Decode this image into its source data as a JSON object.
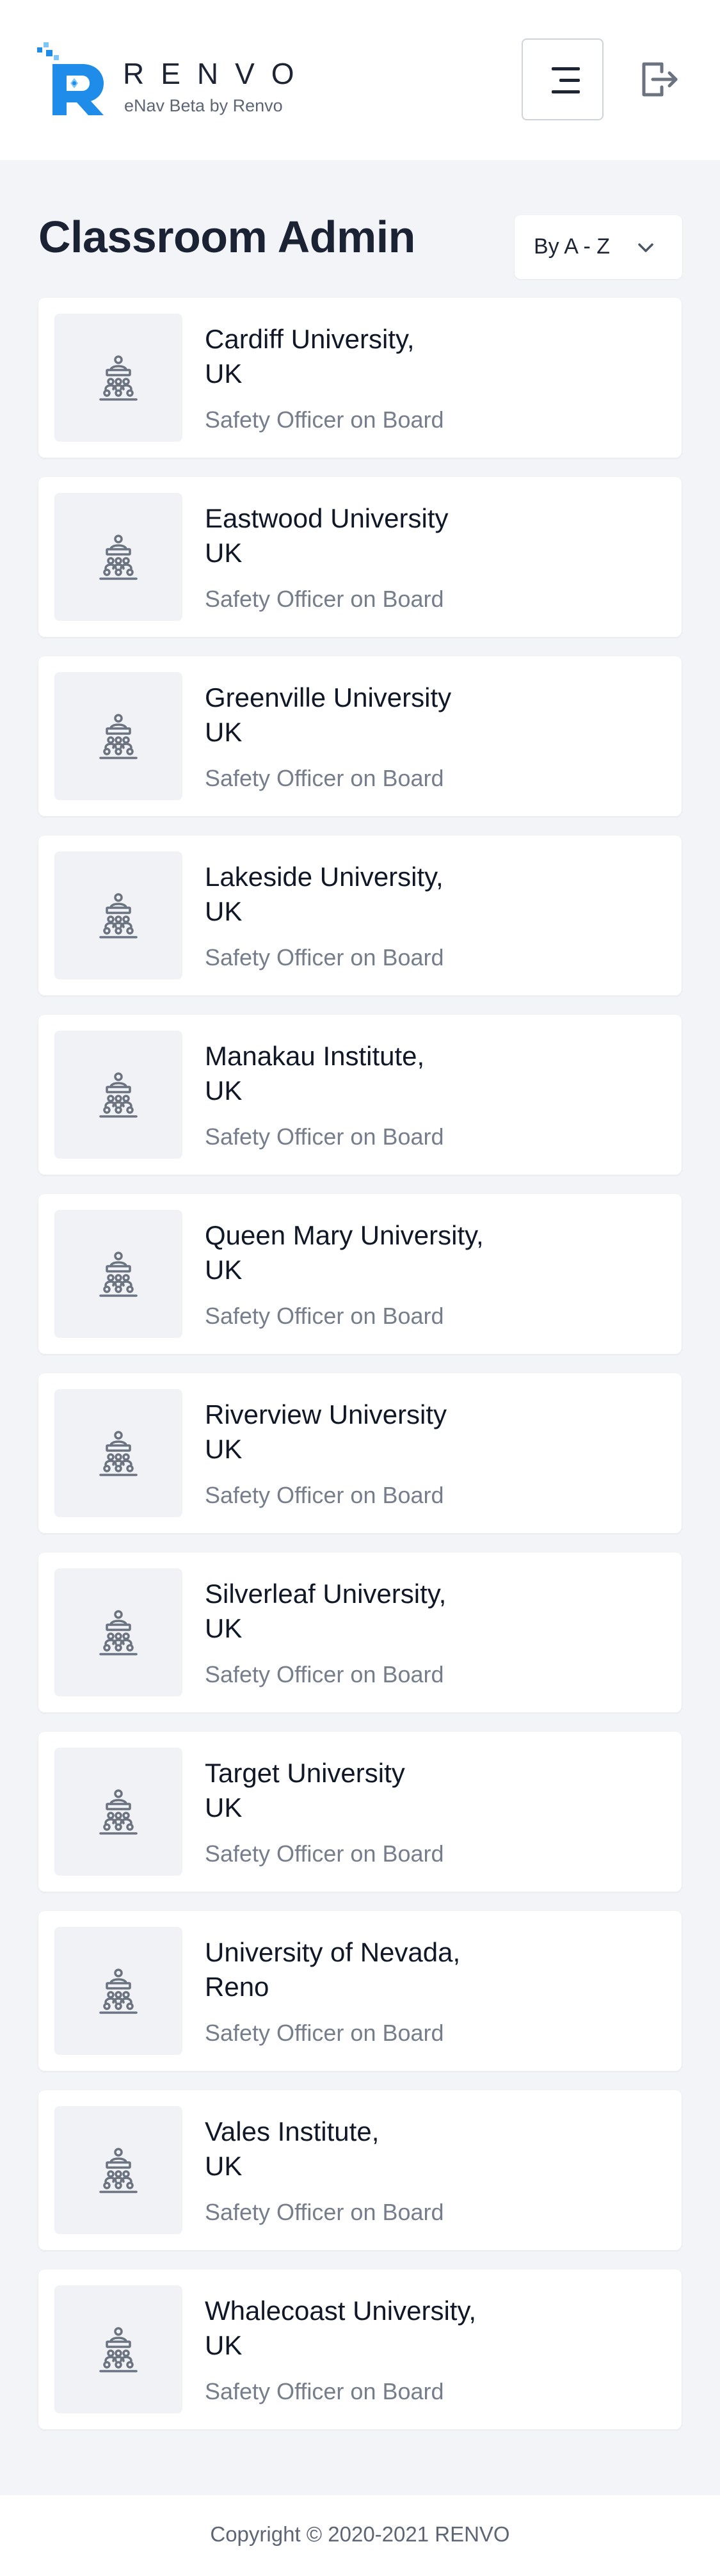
{
  "header": {
    "logo_word": "RENVO",
    "logo_subtitle": "eNav Beta by Renvo"
  },
  "page": {
    "title": "Classroom Admin",
    "sort": {
      "selected": "By A - Z"
    }
  },
  "classrooms": [
    {
      "name": "Cardiff University,\nUK",
      "role": "Safety Officer on Board"
    },
    {
      "name": "Eastwood University\nUK",
      "role": "Safety Officer on Board"
    },
    {
      "name": "Greenville University\nUK",
      "role": "Safety Officer on Board"
    },
    {
      "name": "Lakeside University,\nUK",
      "role": "Safety Officer on Board"
    },
    {
      "name": "Manakau Institute,\nUK",
      "role": "Safety Officer on Board"
    },
    {
      "name": "Queen Mary University,\nUK",
      "role": "Safety Officer on Board"
    },
    {
      "name": "Riverview University\nUK",
      "role": "Safety Officer on Board"
    },
    {
      "name": "Silverleaf University,\nUK",
      "role": "Safety Officer on Board"
    },
    {
      "name": "Target University\nUK",
      "role": "Safety Officer on Board"
    },
    {
      "name": "University of Nevada,\nReno",
      "role": "Safety Officer on Board"
    },
    {
      "name": "Vales Institute,\nUK",
      "role": "Safety Officer on Board"
    },
    {
      "name": "Whalecoast University,\nUK",
      "role": "Safety Officer on Board"
    }
  ],
  "footer": {
    "copyright": "Copyright © 2020-2021 RENVO"
  },
  "icons": {
    "logo": "renvo-logo-icon",
    "menu": "hamburger-menu-icon",
    "logout": "logout-icon",
    "sort": "chevron-down-icon",
    "classroom": "classroom-icon"
  },
  "colors": {
    "brand_blue": "#1e8ce8",
    "brand_light": "#7fc6f7",
    "background": "#f3f4f7",
    "text_primary": "#101828",
    "text_secondary": "#767d8b"
  }
}
